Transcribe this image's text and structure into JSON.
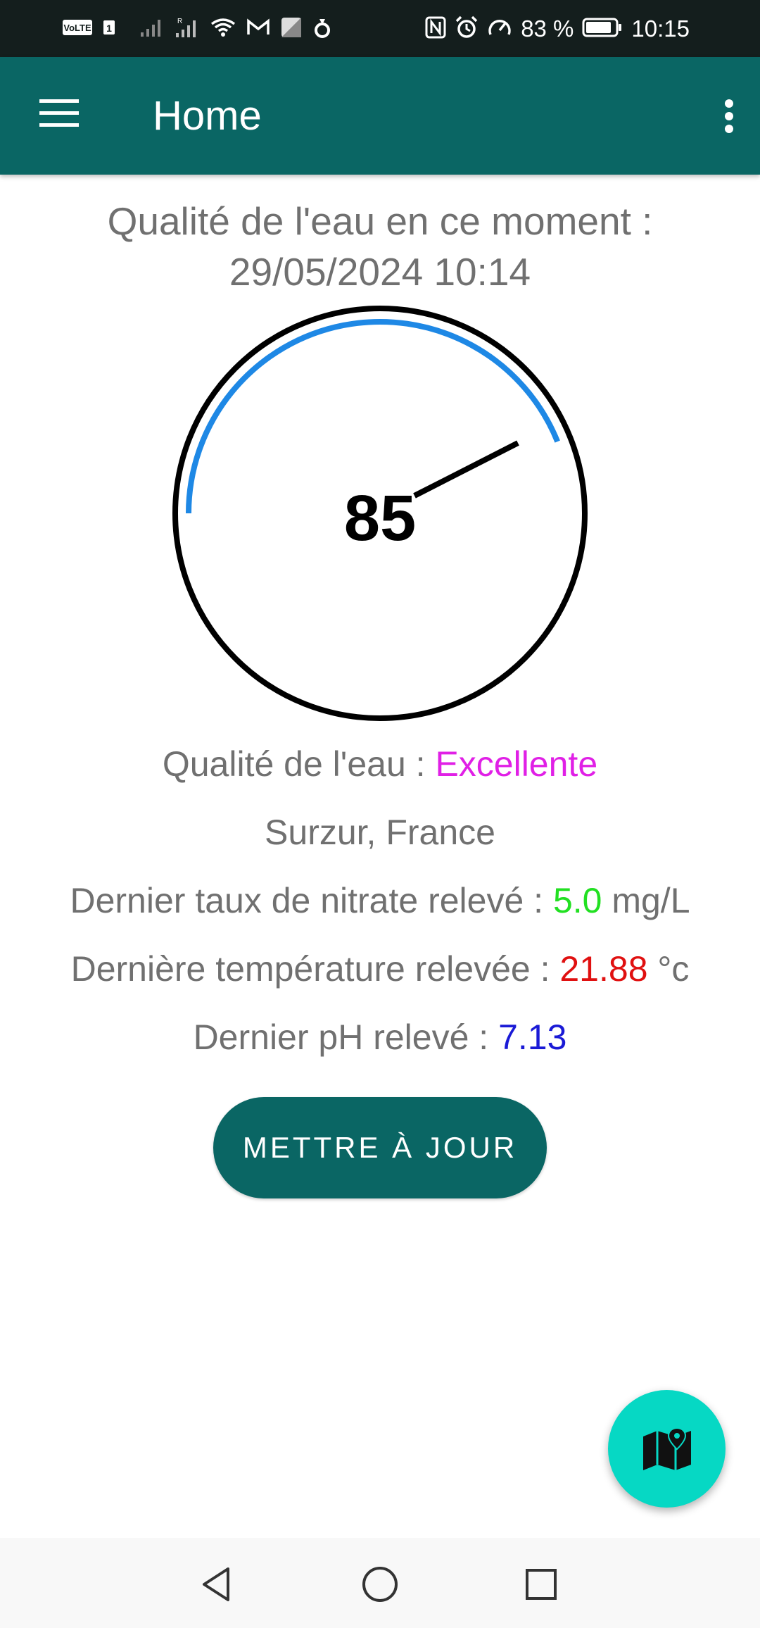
{
  "status_bar": {
    "left_icons": [
      "volte-icon",
      "sim1-icon",
      "signal-icon",
      "signal-roaming-icon",
      "wifi-icon",
      "gmail-icon",
      "app-notification-icon",
      "app-notification-icon-2"
    ],
    "right_icons": [
      "nfc-icon",
      "alarm-icon",
      "speed-icon"
    ],
    "battery_text": "83 %",
    "battery_icon": "battery-icon",
    "time": "10:15"
  },
  "app_bar": {
    "title": "Home",
    "menu_icon": "hamburger-menu-icon",
    "overflow_icon": "more-vert-icon",
    "color": "#0a6664"
  },
  "main": {
    "headline_line1": "Qualité de l'eau en ce moment :",
    "headline_line2": "29/05/2024 10:14",
    "gauge": {
      "value": 85,
      "value_text": "85",
      "arc_color": "#1e88e5"
    },
    "quality_label": "Qualité de l'eau : ",
    "quality_value": "Excellente",
    "location": "Surzur, France",
    "nitrate_label": "Dernier taux de nitrate relevé : ",
    "nitrate_value": "5.0",
    "nitrate_unit": " mg/L",
    "temperature_label": "Dernière température relevée : ",
    "temperature_value": "21.88",
    "temperature_unit": " °c",
    "ph_label": "Dernier pH relevé : ",
    "ph_value": "7.13",
    "update_button": "METTRE À JOUR",
    "fab_icon": "map-icon"
  },
  "nav_bar": {
    "back_icon": "back-icon",
    "home_icon": "home-icon",
    "recents_icon": "recents-icon"
  },
  "colors": {
    "quality": "#e020e6",
    "nitrate": "#22e022",
    "temperature": "#e01010",
    "ph": "#1a1ad6",
    "fab": "#06d8c4"
  }
}
